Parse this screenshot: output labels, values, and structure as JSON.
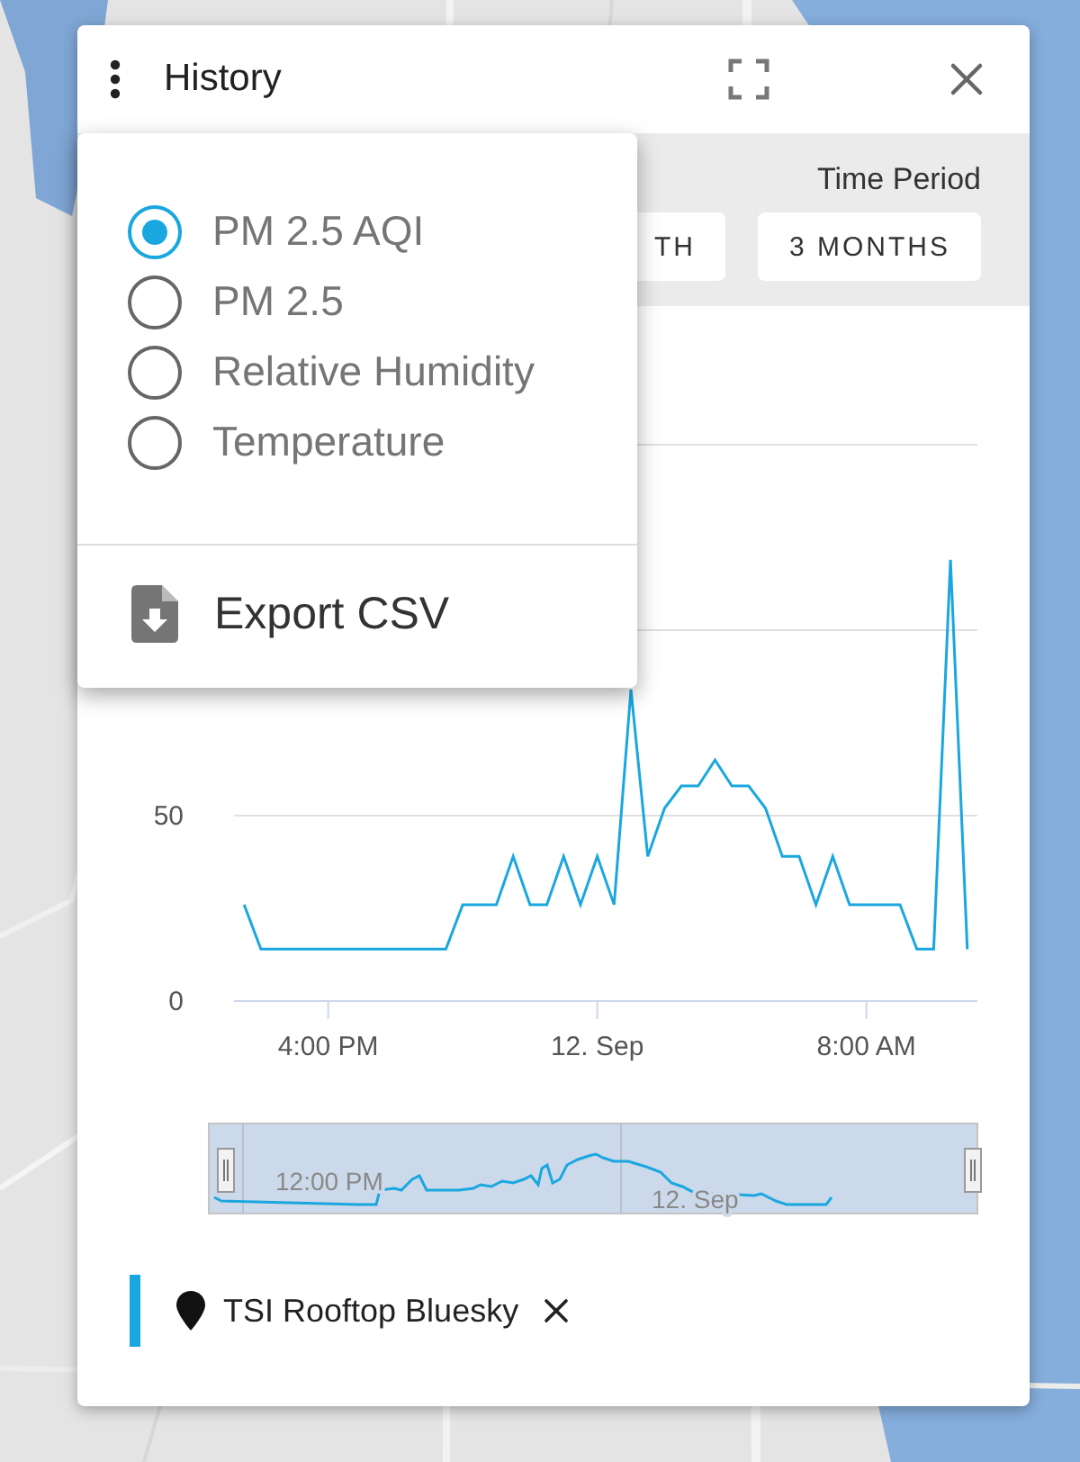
{
  "panel": {
    "title": "History"
  },
  "toolbar": {
    "label": "Time Period",
    "buttons": [
      {
        "label": "TH"
      },
      {
        "label": "3 MONTHS"
      }
    ]
  },
  "menu": {
    "options": [
      {
        "label": "PM 2.5 AQI",
        "selected": true
      },
      {
        "label": "PM 2.5",
        "selected": false
      },
      {
        "label": "Relative Humidity",
        "selected": false
      },
      {
        "label": "Temperature",
        "selected": false
      }
    ],
    "actions": [
      {
        "label": "Export CSV"
      }
    ]
  },
  "chart": {
    "chart_data": {
      "type": "line",
      "ylim": [
        0,
        150
      ],
      "yticks": [
        0,
        50
      ],
      "categories": [
        null,
        null,
        null,
        null,
        null,
        "4:00 PM",
        null,
        null,
        null,
        null,
        null,
        null,
        null,
        null,
        null,
        null,
        null,
        null,
        null,
        null,
        null,
        "12. Sep",
        null,
        null,
        null,
        null,
        null,
        null,
        null,
        null,
        null,
        null,
        null,
        null,
        null,
        null,
        null,
        "8:00 AM",
        null,
        null,
        null,
        null,
        null,
        null
      ],
      "series": [
        {
          "name": "TSI Rooftop Bluesky",
          "color": "#1aa7e0",
          "values": [
            26,
            14,
            14,
            14,
            14,
            14,
            14,
            14,
            14,
            14,
            14,
            14,
            14,
            26,
            26,
            26,
            39,
            26,
            26,
            39,
            26,
            39,
            26,
            84,
            39,
            52,
            58,
            58,
            65,
            58,
            58,
            52,
            39,
            39,
            26,
            39,
            26,
            26,
            26,
            26,
            14,
            14,
            119,
            14
          ]
        }
      ]
    }
  },
  "navigator": {
    "labels": [
      "12:00 PM",
      "12. Sep"
    ]
  }
}
